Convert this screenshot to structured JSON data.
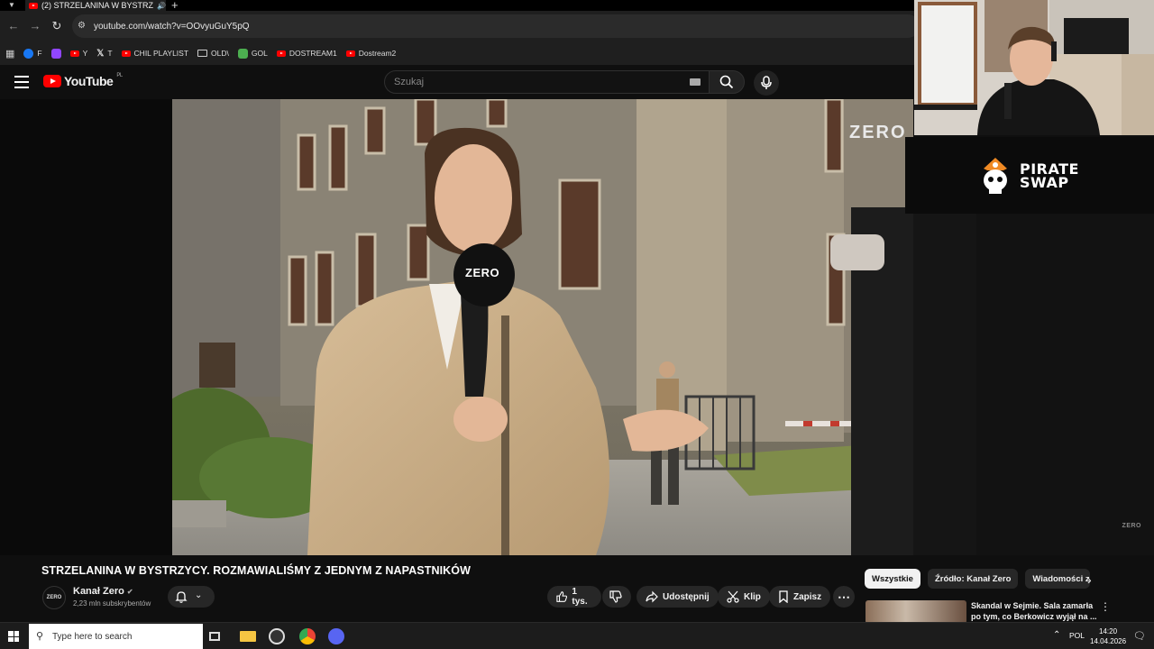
{
  "browser": {
    "tab_title": "(2) STRZELANINA W BYSTRZ",
    "url": "youtube.com/watch?v=OOvyuGuY5pQ",
    "bookmarks": [
      {
        "label": "F",
        "color": "#1877f2"
      },
      {
        "label": "",
        "color": "#9146ff"
      },
      {
        "label": "Y",
        "color": "#ff0000"
      },
      {
        "label": "T",
        "color": "#ffffff"
      },
      {
        "label": "CHIL PLAYLIST",
        "color": "#ff0000"
      },
      {
        "label": "OLD\\",
        "color": "folder"
      },
      {
        "label": "GOL",
        "color": "#2e7d32"
      },
      {
        "label": "DOSTREAM1",
        "color": "#ff0000"
      },
      {
        "label": "Dostream2",
        "color": "#ff0000"
      }
    ]
  },
  "youtube": {
    "logo_text": "YouTube",
    "logo_region": "PL",
    "search_placeholder": "Szukaj"
  },
  "video": {
    "mic_logo": "ZERO",
    "watermark": "ZERO",
    "corner_watermark": "ZERO",
    "title": "STRZELANINA W BYSTRZYCY. ROZMAWIALIŚMY Z JEDNYM Z NAPASTNIKÓW"
  },
  "overlay": {
    "sponsor_line1": "PIRATE",
    "sponsor_line2": "SWAP"
  },
  "channel": {
    "avatar_text": "ZERO",
    "name": "Kanał Zero",
    "subscribers": "2,23 mln subskrybentów"
  },
  "actions": {
    "likes": "1 tys.",
    "share": "Udostępnij",
    "clip": "Klip",
    "save": "Zapisz"
  },
  "chips": [
    "Wszystkie",
    "Źródło: Kanał Zero",
    "Wiadomości z"
  ],
  "recommendation": {
    "title": "Skandal w Sejmie. Sala zamarła po tym, co Berkowicz wyjął na ..."
  },
  "taskbar": {
    "search_placeholder": "Type here to search",
    "language": "POL",
    "time": "14:20",
    "date": "14.04.2026"
  }
}
